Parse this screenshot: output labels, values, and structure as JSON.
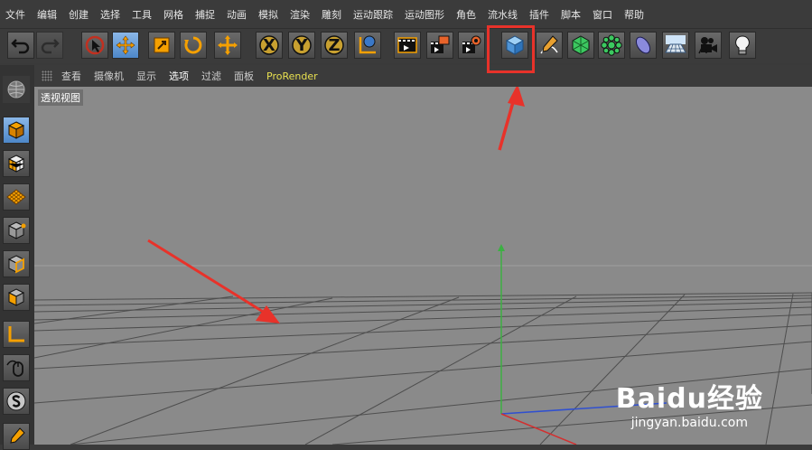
{
  "menubar": {
    "items": [
      "文件",
      "编辑",
      "创建",
      "选择",
      "工具",
      "网格",
      "捕捉",
      "动画",
      "模拟",
      "渲染",
      "雕刻",
      "运动跟踪",
      "运动图形",
      "角色",
      "流水线",
      "插件",
      "脚本",
      "窗口",
      "帮助"
    ]
  },
  "toolbar": {
    "buttons": [
      {
        "name": "undo-icon"
      },
      {
        "name": "redo-icon"
      },
      {
        "name": "live-selection-icon"
      },
      {
        "name": "move-icon"
      },
      {
        "name": "scale-icon"
      },
      {
        "name": "rotate-icon"
      },
      {
        "name": "recent-tool-icon"
      },
      {
        "name": "x-axis-lock-icon",
        "label": "X"
      },
      {
        "name": "y-axis-lock-icon",
        "label": "Y"
      },
      {
        "name": "z-axis-lock-icon",
        "label": "Z"
      },
      {
        "name": "world-coordinates-icon"
      },
      {
        "name": "render-view-icon"
      },
      {
        "name": "render-to-picture-viewer-icon"
      },
      {
        "name": "render-settings-icon"
      },
      {
        "name": "cube-object-icon"
      },
      {
        "name": "pen-spline-icon"
      },
      {
        "name": "subdivision-surface-icon"
      },
      {
        "name": "cloner-icon"
      },
      {
        "name": "deformer-icon"
      },
      {
        "name": "floor-icon"
      },
      {
        "name": "camera-icon"
      },
      {
        "name": "light-icon"
      }
    ]
  },
  "view_menu": {
    "items": [
      "查看",
      "摄像机",
      "显示",
      "选项",
      "过滤",
      "面板",
      "ProRender"
    ],
    "active": "选项"
  },
  "viewport": {
    "label": "透视视图"
  },
  "watermark": {
    "brand": "Baidu经验",
    "url": "jingyan.baidu.com"
  },
  "colors": {
    "highlight_box": "#e8322a",
    "arrow": "#e8322a",
    "y_axis": "#3cb043",
    "x_axis": "#d23030",
    "z_axis": "#3050d0"
  }
}
